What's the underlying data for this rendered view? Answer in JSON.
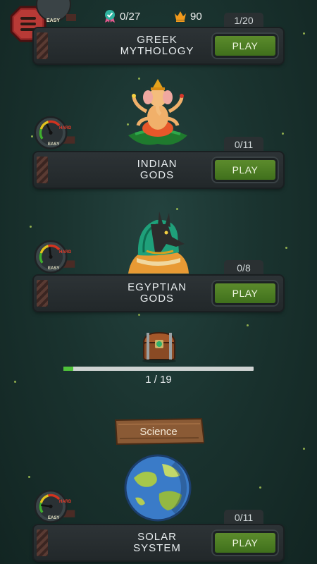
{
  "header": {
    "badges_count": "0/27",
    "crowns_count": "90"
  },
  "categories": [
    {
      "title_line1": "GREEK",
      "title_line2": "MYTHOLOGY",
      "progress": "1/20",
      "play_label": "PLAY",
      "difficulty": "EASY"
    },
    {
      "title_line1": "INDIAN",
      "title_line2": "GODS",
      "progress": "0/11",
      "play_label": "PLAY",
      "difficulty": "EASY",
      "gauge_easy": "EASY",
      "gauge_hard": "HARD"
    },
    {
      "title_line1": "EGYPTIAN",
      "title_line2": "GODS",
      "progress": "0/8",
      "play_label": "PLAY",
      "difficulty": "EASY",
      "gauge_easy": "EASY",
      "gauge_hard": "HARD"
    },
    {
      "title_line1": "SOLAR",
      "title_line2": "SYSTEM",
      "progress": "0/11",
      "play_label": "PLAY",
      "difficulty": "EASY",
      "gauge_easy": "EASY",
      "gauge_hard": "HARD"
    }
  ],
  "chest_progress": {
    "text": "1 / 19",
    "value": 1,
    "max": 19
  },
  "section": {
    "label": "Science"
  },
  "colors": {
    "play_green": "#4f7f24",
    "progress_green": "#4fc23a",
    "background": "#1a332f"
  }
}
